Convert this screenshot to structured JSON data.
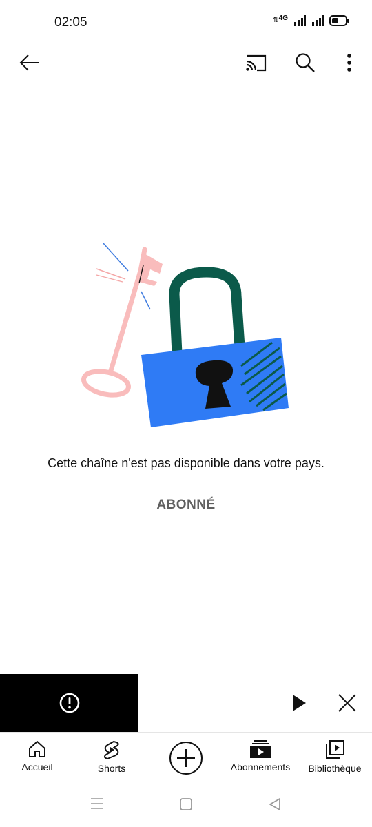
{
  "status_bar": {
    "time": "02:05",
    "network": "4G",
    "icons": [
      "data-arrows-icon",
      "signal-icon",
      "signal-icon",
      "battery-icon"
    ]
  },
  "app_bar": {
    "icons": [
      "back-arrow-icon",
      "cast-icon",
      "search-icon",
      "more-vert-icon"
    ]
  },
  "content": {
    "message": "Cette chaîne n'est pas disponible dans votre pays.",
    "subscribed_label": "ABONNÉ",
    "illustration": "key-and-padlock"
  },
  "mini_player": {
    "thumbnail_icon": "error-circle-icon",
    "controls": [
      "play-icon",
      "close-icon"
    ]
  },
  "bottom_nav": {
    "items": [
      {
        "label": "Accueil",
        "icon": "home-icon"
      },
      {
        "label": "Shorts",
        "icon": "shorts-icon"
      },
      {
        "label": "",
        "icon": "create-plus-icon"
      },
      {
        "label": "Abonnements",
        "icon": "subscriptions-icon"
      },
      {
        "label": "Bibliothèque",
        "icon": "library-icon"
      }
    ]
  },
  "system_nav": {
    "icons": [
      "menu-lines-icon",
      "home-square-icon",
      "back-triangle-icon"
    ]
  },
  "colors": {
    "lock_body": "#2f7bf5",
    "lock_shackle": "#0b5a4a",
    "key": "#f9bcbc",
    "accent_blue_line": "#3f7ce0",
    "muted_text": "#606060"
  }
}
